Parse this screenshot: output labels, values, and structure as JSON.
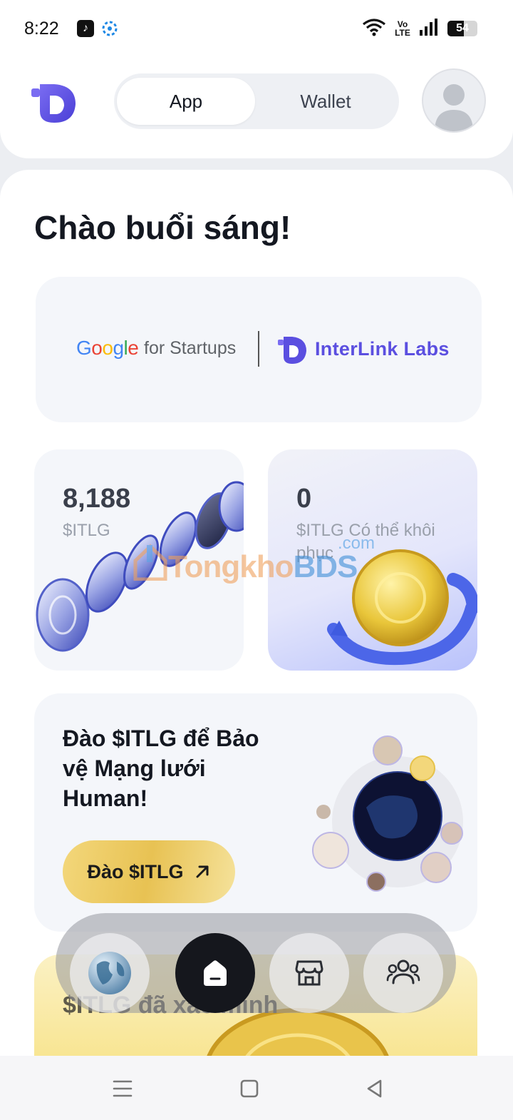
{
  "status_bar": {
    "time": "8:22",
    "network_label": "Vo LTE",
    "battery": "54",
    "battery_level": 0.54
  },
  "header": {
    "tabs": [
      {
        "label": "App",
        "active": true
      },
      {
        "label": "Wallet",
        "active": false
      }
    ]
  },
  "main": {
    "greeting": "Chào buổi sáng!",
    "partner_banner": {
      "google_wordmark": "Google",
      "google_sub": "for Startups",
      "partner_name": "InterLink Labs"
    },
    "balance_cards": [
      {
        "value": "8,188",
        "label": "$ITLG"
      },
      {
        "value": "0",
        "label": "$ITLG Có thể khôi phục"
      }
    ],
    "mine_card": {
      "title": "Đào $ITLG để Bảo vệ Mạng lưới Human!",
      "button_label": "Đào $ITLG"
    },
    "verified_card": {
      "title": "$ITLG đã xác minh"
    }
  },
  "bottom_nav": {
    "items": [
      {
        "icon": "globe-icon",
        "active": false
      },
      {
        "icon": "home-icon",
        "active": true
      },
      {
        "icon": "store-icon",
        "active": false
      },
      {
        "icon": "community-icon",
        "active": false
      }
    ]
  },
  "watermark": {
    "brand_left": "Tongkho",
    "brand_right": "BDS",
    "domain": ".com"
  },
  "colors": {
    "brand_purple": "#5b4fe0",
    "gold": "#e8c253",
    "dark": "#15171d"
  }
}
